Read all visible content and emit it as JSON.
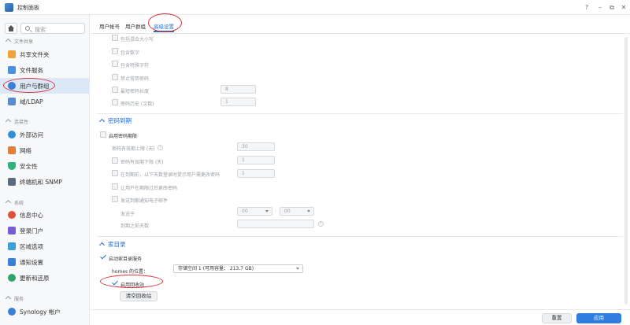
{
  "window": {
    "title": "控制面板",
    "help": "?",
    "minimize": "–",
    "restore": "⧉",
    "close": "✕"
  },
  "sidebar": {
    "search_placeholder": "搜索",
    "sections": [
      {
        "label": "文件共享"
      },
      {
        "label": "连接性"
      },
      {
        "label": "系统"
      },
      {
        "label": "服务"
      }
    ],
    "items": [
      {
        "label": "共享文件夹",
        "icon": "folder-icon",
        "color": "#f0a23b"
      },
      {
        "label": "文件服务",
        "icon": "file-services-icon",
        "color": "#4a8fe0"
      },
      {
        "label": "用户与群组",
        "icon": "users-icon",
        "color": "#3b7fd6"
      },
      {
        "label": "域/LDAP",
        "icon": "domain-icon",
        "color": "#5a8ccf"
      },
      {
        "label": "外部访问",
        "icon": "globe-icon",
        "color": "#2f8fd8"
      },
      {
        "label": "网络",
        "icon": "network-icon",
        "color": "#e0803b"
      },
      {
        "label": "安全性",
        "icon": "shield-icon",
        "color": "#2fb37a"
      },
      {
        "label": "终端机和 SNMP",
        "icon": "terminal-icon",
        "color": "#5b6a7d"
      },
      {
        "label": "信息中心",
        "icon": "info-icon",
        "color": "#e0503b"
      },
      {
        "label": "登录门户",
        "icon": "portal-icon",
        "color": "#7a5bd6"
      },
      {
        "label": "区域选项",
        "icon": "region-icon",
        "color": "#3ba0d6"
      },
      {
        "label": "通知设置",
        "icon": "notification-icon",
        "color": "#3b7fd6"
      },
      {
        "label": "更新和还原",
        "icon": "update-icon",
        "color": "#2fa56a"
      },
      {
        "label": "Synology 帐户",
        "icon": "account-icon",
        "color": "#3b7fd6"
      }
    ]
  },
  "tabs": [
    {
      "label": "用户帐号"
    },
    {
      "label": "用户群组"
    },
    {
      "label": "高级设置"
    }
  ],
  "password_rules": {
    "items": [
      {
        "label": "包括混合大小写"
      },
      {
        "label": "包含数字"
      },
      {
        "label": "包含特殊字符"
      },
      {
        "label": "禁止常用密码"
      },
      {
        "label": "最短密码长度",
        "value": "8"
      },
      {
        "label": "密码历史 (次数)",
        "value": "1"
      }
    ]
  },
  "password_expiry": {
    "title": "密码到期",
    "enable_label": "启用密码期限",
    "max_age_label": "密码有效期上限 (天)",
    "max_age_value": "30",
    "min_age_label": "密码有效期下限 (天)",
    "min_age_value": "1",
    "notify_label": "在到期前，以下天数登录时提示用户需更改密码",
    "notify_value": "1",
    "allow_reset_label": "让用户在期限过后更改密码",
    "email_label": "发送到期通知电子邮件",
    "send_at_label": "发送于",
    "hour_value": "00",
    "colon": ":",
    "minute_value": "00",
    "days_before_label": "到期之前天数"
  },
  "home": {
    "title": "家目录",
    "enable_label": "启动家目录服务",
    "location_label": "homes 的位置：",
    "location_value": "存储空间 1 (可用容量： 213.7 GB)",
    "recycle_label": "启用回收站",
    "empty_recycle_button": "清空回收站"
  },
  "footer": {
    "reset": "重置",
    "apply": "应用"
  },
  "colors": {
    "accent": "#1d6ed8",
    "annotation": "#d9343a"
  }
}
